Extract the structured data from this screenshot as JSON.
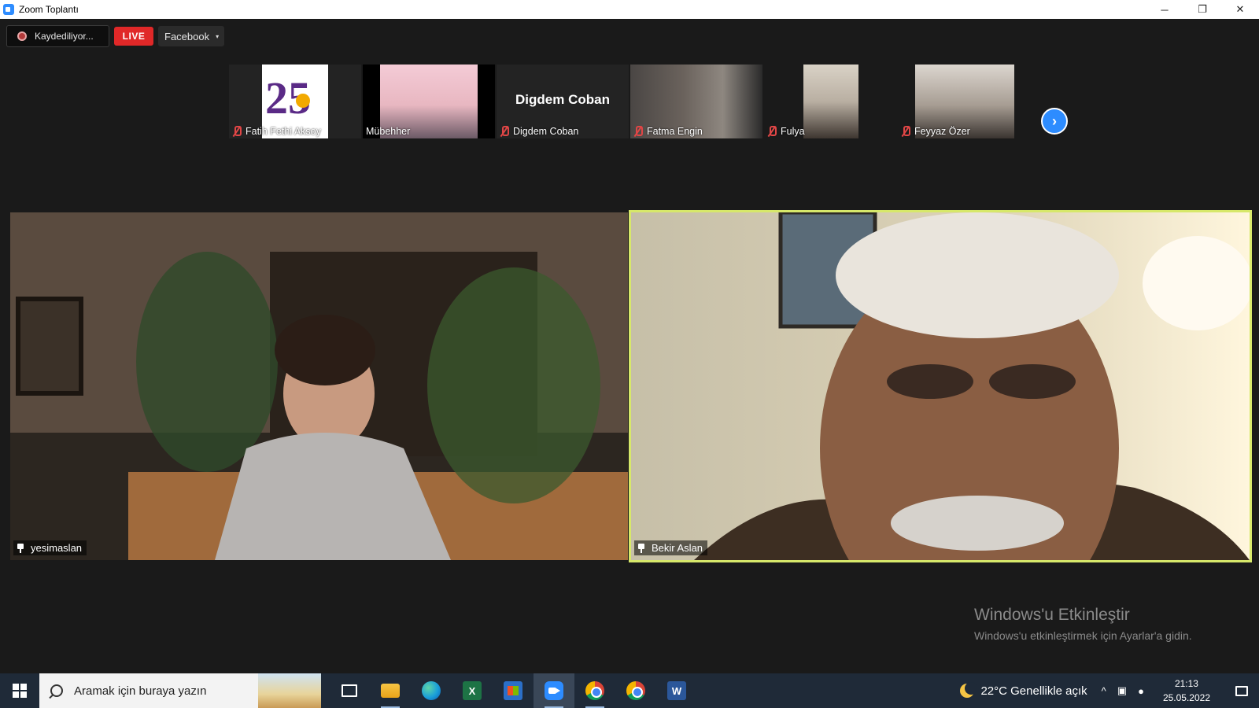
{
  "window": {
    "title": "Zoom Toplantı",
    "controls": {
      "minimize": "─",
      "restore": "❐",
      "close": "✕"
    }
  },
  "toolbar": {
    "recording_label": "Kaydediliyor...",
    "live_label": "LIVE",
    "stream_target": "Facebook",
    "caret": "▾"
  },
  "participants_strip": [
    {
      "name": "Fatih Fethi Aksoy",
      "muted": true,
      "has_video": true
    },
    {
      "name": "Mübehher",
      "muted": false,
      "has_video": true
    },
    {
      "name": "Digdem Coban",
      "display_name": "Digdem Coban",
      "muted": true,
      "has_video": false
    },
    {
      "name": "Fatma Engin",
      "muted": true,
      "has_video": true
    },
    {
      "name": "Fulya",
      "muted": true,
      "has_video": true
    },
    {
      "name": "Feyyaz Özer",
      "muted": true,
      "has_video": true
    }
  ],
  "next_page_glyph": "›",
  "main_videos": [
    {
      "name": "yesimaslan",
      "pinned": true,
      "active_speaker": false
    },
    {
      "name": "Bekir Aslan",
      "pinned": true,
      "active_speaker": true
    }
  ],
  "watermark": {
    "title": "Windows'u Etkinleştir",
    "subtitle": "Windows'u etkinleştirmek için Ayarlar'a gidin."
  },
  "taskbar": {
    "search_placeholder": "Aramak için buraya yazın",
    "apps": [
      "task-view",
      "file-explorer",
      "edge",
      "excel",
      "microsoft-store",
      "zoom",
      "chrome-profile",
      "chrome",
      "word"
    ],
    "excel_letter": "X",
    "word_letter": "W",
    "weather": "22°C  Genellikle açık",
    "tray_chevron": "^",
    "tray_camera": "▣",
    "tray_mic": "●",
    "time": "21:13",
    "date": "25.05.2022"
  },
  "colors": {
    "active_speaker_border": "#d7e86a",
    "live_red": "#e02828",
    "zoom_blue": "#2d8cff",
    "taskbar_bg": "#1f2a38"
  }
}
